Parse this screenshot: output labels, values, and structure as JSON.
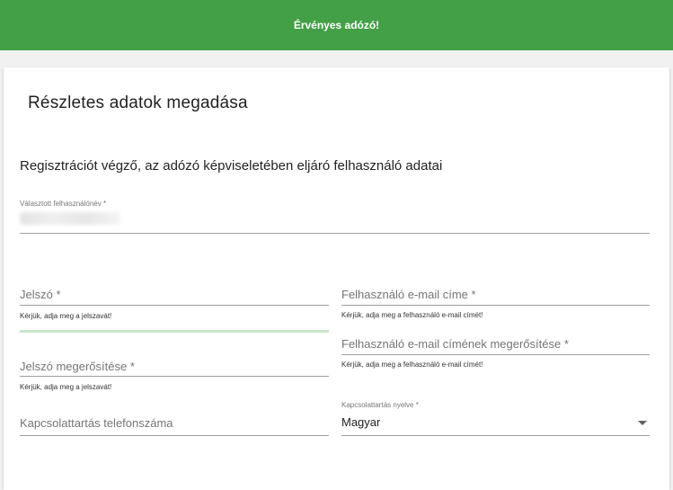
{
  "banner": {
    "text": "Érvényes adózó!",
    "color": "#43a047"
  },
  "card": {
    "title": "Részletes adatok megadása",
    "section_title": "Regisztrációt végző, az adózó képviseletében eljáró felhasználó adatai"
  },
  "fields": {
    "username": {
      "label": "Választott felhasználónév *"
    },
    "password": {
      "placeholder": "Jelszó *",
      "hint": "Kérjük, adja meg a jelszavát!"
    },
    "password_confirm": {
      "placeholder": "Jelszó megerősítése *",
      "hint": "Kérjük, adja meg a jelszavát!"
    },
    "phone": {
      "placeholder": "Kapcsolattartás telefonszáma"
    },
    "email": {
      "placeholder": "Felhasználó e-mail címe *",
      "hint": "Kérjük, adja meg a felhasználó e-mail címét!"
    },
    "email_confirm": {
      "placeholder": "Felhasználó e-mail címének megerősítése *",
      "hint": "Kérjük, adja meg a felhasználó e-mail címét!"
    },
    "language": {
      "label": "Kapcsolattartás nyelve *",
      "value": "Magyar"
    }
  }
}
